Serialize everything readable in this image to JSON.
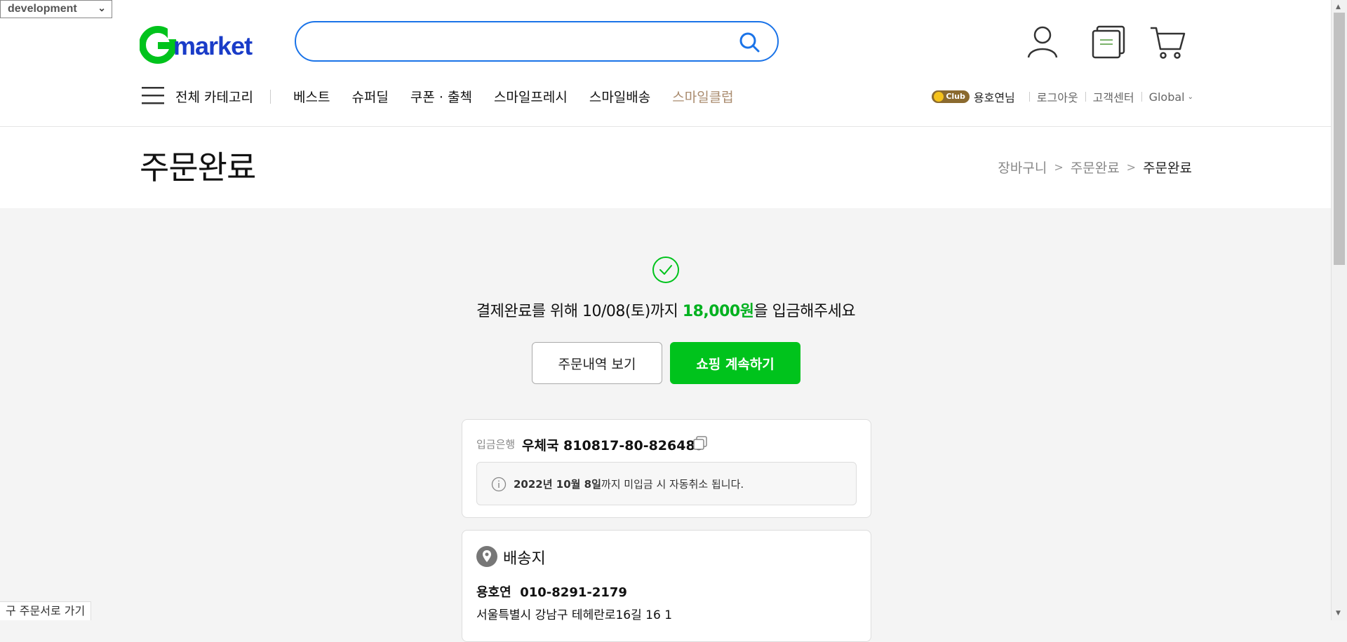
{
  "env": {
    "selected": "development"
  },
  "header": {
    "logo_text": "Gmarket",
    "search": {
      "placeholder": "",
      "value": ""
    },
    "icons": [
      "user-icon",
      "recent-items-icon",
      "cart-icon"
    ]
  },
  "nav": {
    "all_categories": "전체 카테고리",
    "items": [
      "베스트",
      "슈퍼딜",
      "쿠폰 · 출첵",
      "스마일프레시",
      "스마일배송",
      "스마일클럽"
    ]
  },
  "util": {
    "club_badge": "Club",
    "user_name": "용호연님",
    "logout": "로그아웃",
    "customer_center": "고객센터",
    "global": "Global"
  },
  "page": {
    "title": "주문완료",
    "breadcrumb": [
      "장바구니",
      "주문완료",
      "주문완료"
    ]
  },
  "complete": {
    "message_prefix": "결제완료를 위해 10/08(토)까지 ",
    "amount": "18,000원",
    "message_suffix": "을 입금해주세요",
    "history_button": "주문내역 보기",
    "continue_button": "쇼핑 계속하기"
  },
  "bank": {
    "label": "입금은행",
    "value": "우체국 810817-80-826489",
    "notice_bold": "2022년 10월 8일",
    "notice_rest": "까지 미입금 시 자동취소 됩니다."
  },
  "address": {
    "title": "배송지",
    "name": "용호연",
    "phone": "010-8291-2179",
    "line": "서울특별시 강남구 테헤란로16길 16 1"
  },
  "footer": {
    "old_order_link": "구 주문서로 가기"
  },
  "colors": {
    "accent_green": "#00c31c",
    "search_blue": "#1a73e8",
    "club_brown": "#a98b6e"
  }
}
